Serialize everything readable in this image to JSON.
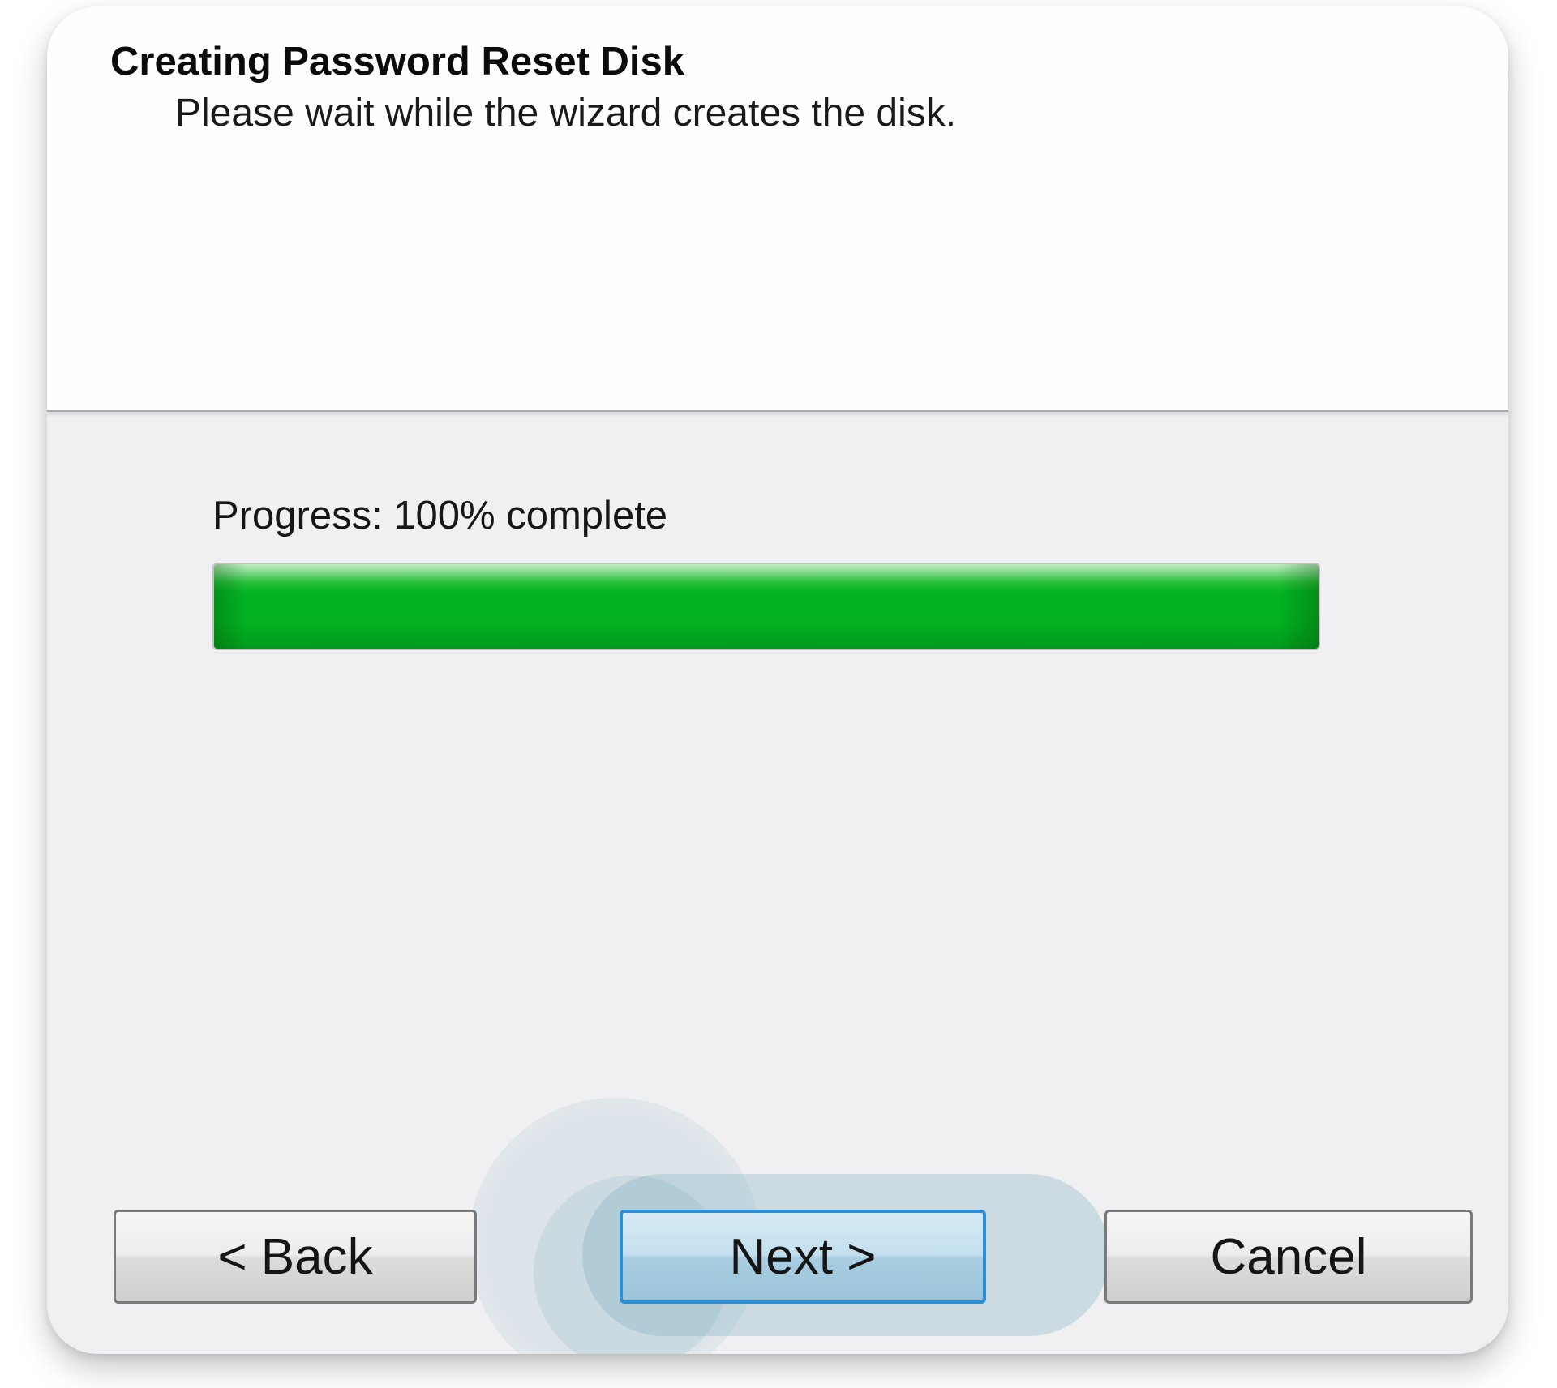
{
  "dialog": {
    "title": "Creating Password Reset Disk",
    "subtitle": "Please wait while the wizard creates the disk."
  },
  "progress": {
    "label": "Progress: 100% complete",
    "value_percent": 100,
    "fill_color": "#02b020"
  },
  "buttons": {
    "back_label": "< Back",
    "next_label": "Next >",
    "cancel_label": "Cancel",
    "focused_accent": "#2c8fd4"
  }
}
